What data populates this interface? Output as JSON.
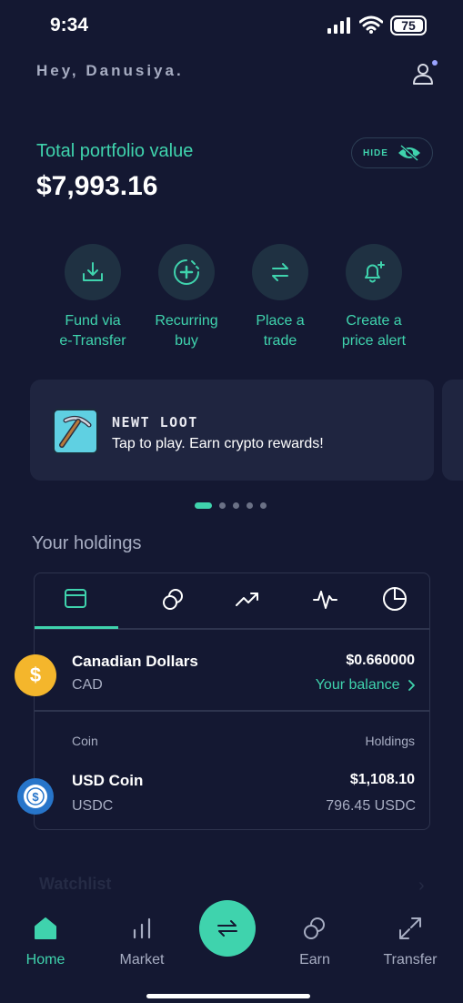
{
  "status_bar": {
    "time": "9:34",
    "battery": "75"
  },
  "header": {
    "greeting": "Hey, Danusiya."
  },
  "portfolio": {
    "label": "Total portfolio value",
    "value": "$7,993.16",
    "hide_label": "HIDE"
  },
  "actions": [
    {
      "line1": "Fund via",
      "line2": "e-Transfer",
      "icon": "download-icon"
    },
    {
      "line1": "Recurring",
      "line2": "buy",
      "icon": "recurring-plus-icon"
    },
    {
      "line1": "Place a",
      "line2": "trade",
      "icon": "swap-arrows-icon"
    },
    {
      "line1": "Create a",
      "line2": "price alert",
      "icon": "bell-plus-icon"
    }
  ],
  "promo": {
    "title": "NEWT LOOT",
    "subtitle": "Tap to play. Earn crypto rewards!",
    "icon": "pickaxe-icon"
  },
  "carousel": {
    "count": 5,
    "active": 0
  },
  "holdings": {
    "title": "Your holdings",
    "tabs": [
      "wallet-icon",
      "coins-icon",
      "trend-up-icon",
      "pulse-icon",
      "pie-chart-icon"
    ],
    "cad": {
      "name": "Canadian Dollars",
      "code": "CAD",
      "amount": "$0.660000",
      "balance_link": "Your balance"
    },
    "columns": {
      "coin": "Coin",
      "holdings": "Holdings"
    },
    "usdc": {
      "name": "USD Coin",
      "code": "USDC",
      "amount": "$1,108.10",
      "holdings": "796.45 USDC"
    }
  },
  "watchlist": {
    "title": "Watchlist"
  },
  "nav": {
    "home": "Home",
    "market": "Market",
    "earn": "Earn",
    "transfer": "Transfer"
  },
  "colors": {
    "accent": "#3fd3ad",
    "background": "#141832",
    "cad_coin": "#f4b62c",
    "usdc_coin": "#2775ca"
  }
}
